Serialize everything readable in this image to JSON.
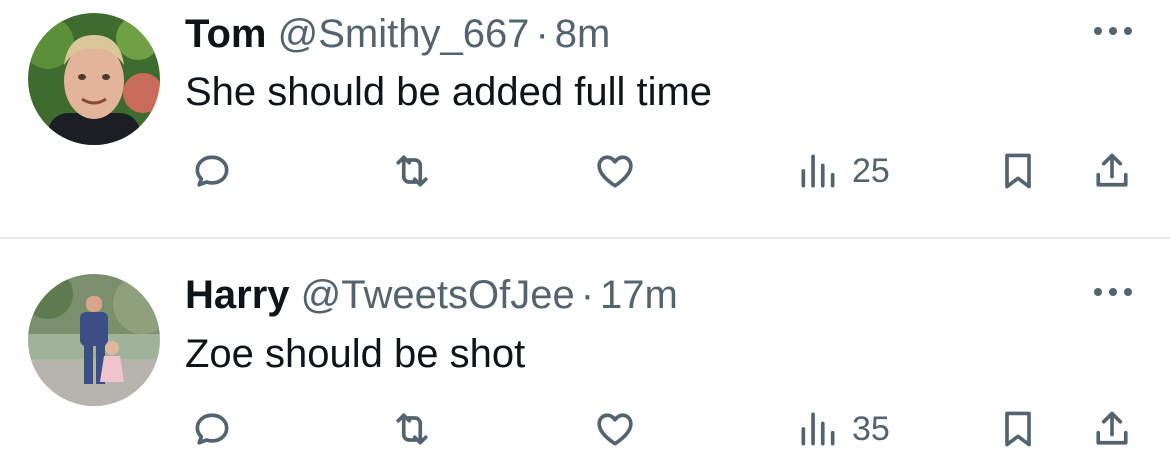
{
  "tweets": [
    {
      "name": "Tom",
      "handle": "@Smithy_667",
      "separator": "·",
      "time": "8m",
      "text": "She should be added full time",
      "views": "25",
      "avatar_icon": "avatar-man-headshot"
    },
    {
      "name": "Harry",
      "handle": "@TweetsOfJee",
      "separator": "·",
      "time": "17m",
      "text": "Zoe should be shot",
      "views": "35",
      "avatar_icon": "avatar-man-with-child"
    }
  ],
  "icons": {
    "reply": "reply-icon",
    "retweet": "retweet-icon",
    "like": "heart-icon",
    "views": "views-icon",
    "bookmark": "bookmark-icon",
    "share": "share-icon",
    "more": "more-icon"
  },
  "colors": {
    "text": "#0f1419",
    "secondary": "#536471",
    "divider": "#e7e9ea"
  }
}
